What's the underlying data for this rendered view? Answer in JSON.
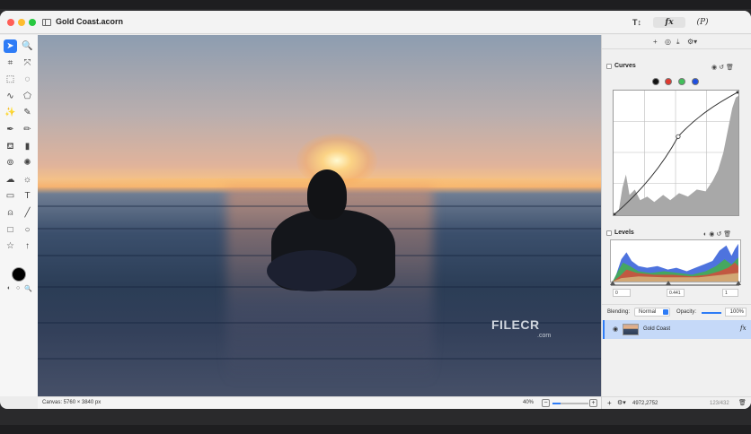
{
  "window": {
    "title": "Gold Coast.acorn"
  },
  "titlebar": {
    "text_tool_label": "T↕",
    "fx_label": "fx",
    "p_label": "(P)"
  },
  "tools": [
    {
      "name": "select-arrow-icon",
      "glyph": "➤"
    },
    {
      "name": "zoom-icon",
      "glyph": "🔍"
    },
    {
      "name": "crop-icon",
      "glyph": "⌗"
    },
    {
      "name": "transform-icon",
      "glyph": "⤧"
    },
    {
      "name": "rect-select-icon",
      "glyph": "⬚"
    },
    {
      "name": "ellipse-select-icon",
      "glyph": "◌"
    },
    {
      "name": "lasso-icon",
      "glyph": "∿"
    },
    {
      "name": "poly-lasso-icon",
      "glyph": "⬠"
    },
    {
      "name": "magic-wand-icon",
      "glyph": "✨"
    },
    {
      "name": "brush-select-icon",
      "glyph": "✎"
    },
    {
      "name": "pen-icon",
      "glyph": "✒"
    },
    {
      "name": "pencil-icon",
      "glyph": "✏"
    },
    {
      "name": "paint-bucket-icon",
      "glyph": "⛾"
    },
    {
      "name": "eraser-icon",
      "glyph": "▮"
    },
    {
      "name": "clone-stamp-icon",
      "glyph": "⊚"
    },
    {
      "name": "burn-icon",
      "glyph": "✺"
    },
    {
      "name": "cloud-icon",
      "glyph": "☁"
    },
    {
      "name": "sun-icon",
      "glyph": "☼"
    },
    {
      "name": "gradient-icon",
      "glyph": "▭"
    },
    {
      "name": "text-icon",
      "glyph": "T"
    },
    {
      "name": "bezier-pen-icon",
      "glyph": "⍝"
    },
    {
      "name": "line-icon",
      "glyph": "╱"
    },
    {
      "name": "rectangle-shape-icon",
      "glyph": "□"
    },
    {
      "name": "circle-shape-icon",
      "glyph": "○"
    },
    {
      "name": "star-shape-icon",
      "glyph": "☆"
    },
    {
      "name": "arrow-shape-icon",
      "glyph": "↑"
    }
  ],
  "statusbar": {
    "canvas_size": "Canvas: 5760 × 3840 px",
    "zoom": "40%",
    "zoom_fraction": 0.22
  },
  "panel": {
    "curves_title": "Curves",
    "levels_title": "Levels",
    "levels_values": {
      "black": "0",
      "gamma": "0.441",
      "white": "1"
    },
    "blending_label": "Blending:",
    "blending_mode": "Normal",
    "opacity_label": "Opacity:",
    "opacity_value": "100%",
    "opacity_fraction": 1.0,
    "layer": {
      "name": "Gold Coast",
      "fx": "fx"
    },
    "footer": {
      "coords": "4972,2752",
      "size": "123/432"
    },
    "channel_colors": [
      "#111111",
      "#e03a2f",
      "#41c05a",
      "#1f4fe0"
    ]
  },
  "watermark": {
    "brand": "FILECR",
    "domain": ".com"
  }
}
